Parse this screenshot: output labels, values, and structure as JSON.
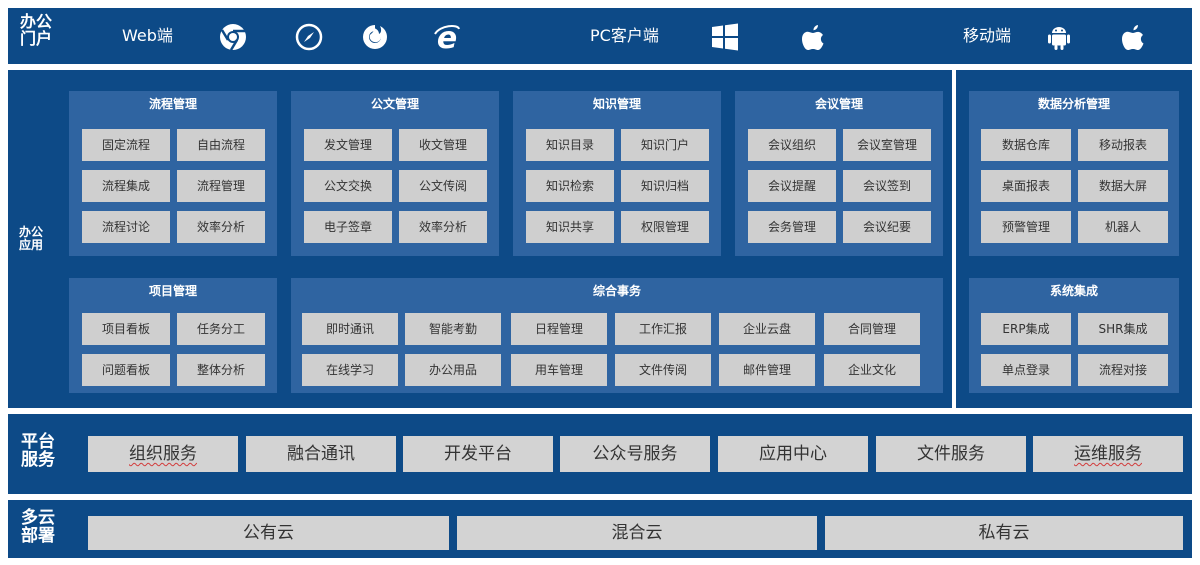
{
  "portal": {
    "label": "办公门户",
    "web_label": "Web端",
    "pc_label": "PC客户端",
    "mobile_label": "移动端",
    "icons": [
      "chrome-icon",
      "safari-icon",
      "firefox-icon",
      "ie-icon",
      "windows-icon",
      "apple-icon",
      "android-icon",
      "apple-icon"
    ]
  },
  "apps": {
    "label": "办公应用",
    "workflow": {
      "title": "流程管理",
      "items": [
        "固定流程",
        "自由流程",
        "流程集成",
        "流程管理",
        "流程讨论",
        "效率分析"
      ]
    },
    "document": {
      "title": "公文管理",
      "items": [
        "发文管理",
        "收文管理",
        "公文交换",
        "公文传阅",
        "电子签章",
        "效率分析"
      ]
    },
    "knowledge": {
      "title": "知识管理",
      "items": [
        "知识目录",
        "知识门户",
        "知识检索",
        "知识归档",
        "知识共享",
        "权限管理"
      ]
    },
    "meeting": {
      "title": "会议管理",
      "items": [
        "会议组织",
        "会议室管理",
        "会议提醒",
        "会议签到",
        "会务管理",
        "会议纪要"
      ]
    },
    "analytics": {
      "title": "数据分析管理",
      "items": [
        "数据仓库",
        "移动报表",
        "桌面报表",
        "数据大屏",
        "预警管理",
        "机器人"
      ]
    },
    "project": {
      "title": "项目管理",
      "items": [
        "项目看板",
        "任务分工",
        "问题看板",
        "整体分析"
      ]
    },
    "affairs": {
      "title": "综合事务",
      "items": [
        "即时通讯",
        "智能考勤",
        "日程管理",
        "工作汇报",
        "企业云盘",
        "合同管理",
        "在线学习",
        "办公用品",
        "用车管理",
        "文件传阅",
        "邮件管理",
        "企业文化"
      ]
    },
    "integration": {
      "title": "系统集成",
      "items": [
        "ERP集成",
        "SHR集成",
        "单点登录",
        "流程对接"
      ]
    }
  },
  "platform": {
    "label": "平台服务",
    "items": [
      "组织服务",
      "融合通讯",
      "开发平台",
      "公众号服务",
      "应用中心",
      "文件服务",
      "运维服务"
    ]
  },
  "cloud": {
    "label": "多云部署",
    "items": [
      "公有云",
      "混合云",
      "私有云"
    ]
  },
  "colors": {
    "band": "#0d4a87",
    "panel": "#2f64a1",
    "cell": "#cfcfcf"
  }
}
